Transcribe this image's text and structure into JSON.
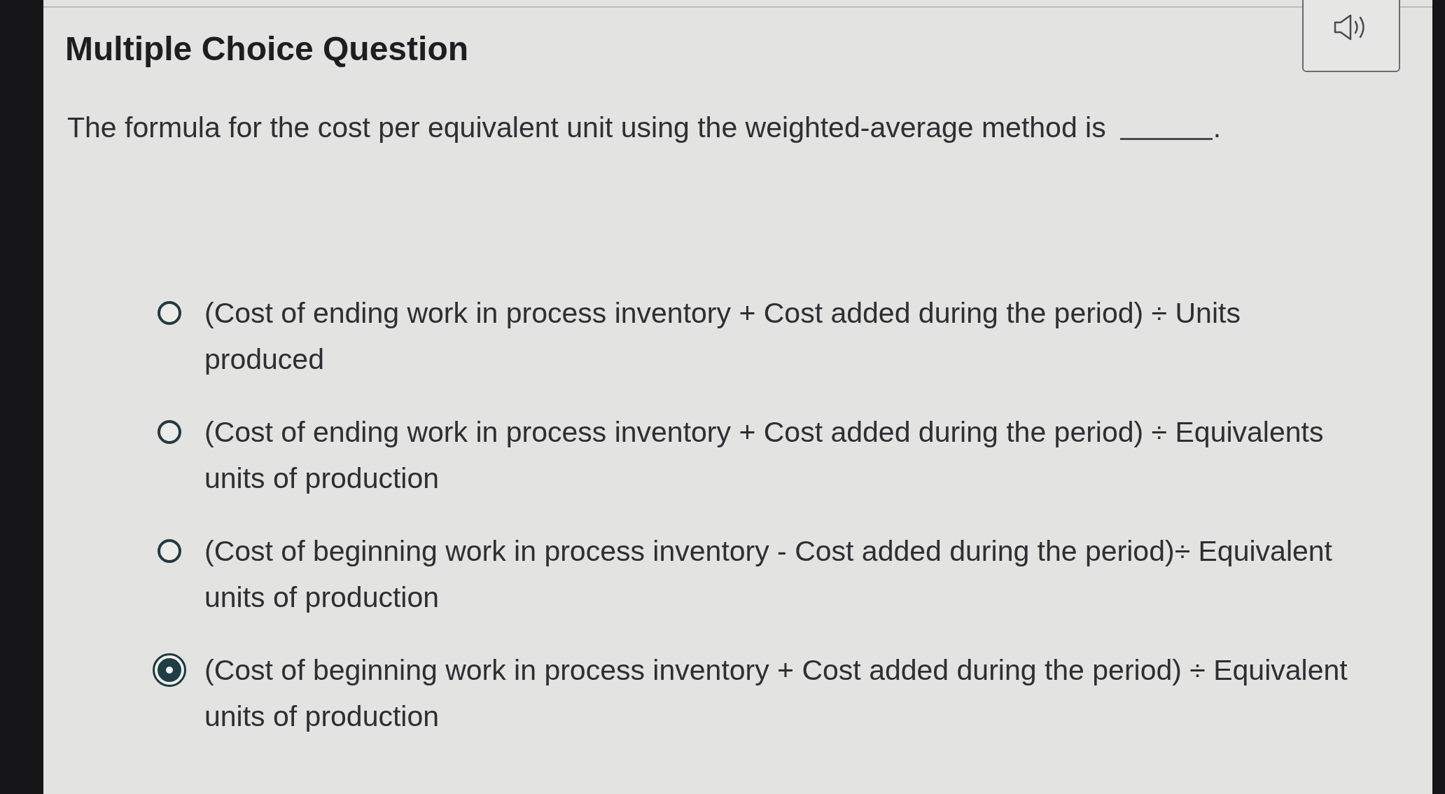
{
  "title": "Multiple Choice Question",
  "question": {
    "text": "The formula for the cost per equivalent unit using the weighted-average method is",
    "end": "."
  },
  "options": [
    {
      "text": "(Cost of ending work in process inventory + Cost added during the period) ÷ Units produced",
      "selected": false
    },
    {
      "text": "(Cost of ending work in process inventory + Cost added during the period) ÷ Equivalents units of production",
      "selected": false
    },
    {
      "text": "(Cost of beginning work in process inventory - Cost added during the period)÷ Equivalent units of production",
      "selected": false
    },
    {
      "text": "(Cost of beginning work in process inventory + Cost added during the period) ÷ Equivalent units of production",
      "selected": true
    }
  ]
}
